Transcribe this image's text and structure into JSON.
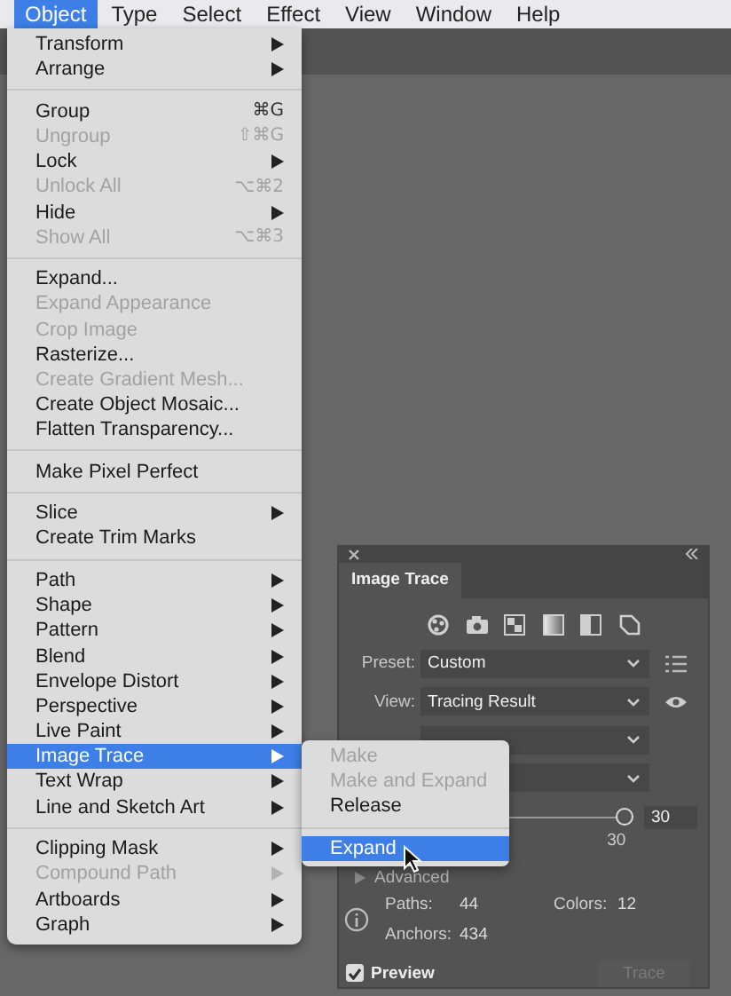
{
  "menubar": [
    {
      "label": "Object",
      "selected": true
    },
    {
      "label": "Type",
      "selected": false
    },
    {
      "label": "Select",
      "selected": false
    },
    {
      "label": "Effect",
      "selected": false
    },
    {
      "label": "View",
      "selected": false
    },
    {
      "label": "Window",
      "selected": false
    },
    {
      "label": "Help",
      "selected": false
    }
  ],
  "menu": {
    "items": [
      {
        "kind": "item",
        "label": "Transform",
        "submenu": true,
        "disabled": false,
        "selected": false
      },
      {
        "kind": "item",
        "label": "Arrange",
        "submenu": true,
        "disabled": false,
        "selected": false
      },
      {
        "kind": "separator"
      },
      {
        "kind": "item",
        "label": "Group",
        "shortcut": "⌘G",
        "disabled": false,
        "selected": false
      },
      {
        "kind": "item",
        "label": "Ungroup",
        "shortcut": "⇧⌘G",
        "disabled": true,
        "selected": false
      },
      {
        "kind": "item",
        "label": "Lock",
        "submenu": true,
        "disabled": false,
        "selected": false
      },
      {
        "kind": "item",
        "label": "Unlock All",
        "shortcut": "⌥⌘2",
        "disabled": true,
        "selected": false
      },
      {
        "kind": "item",
        "label": "Hide",
        "submenu": true,
        "disabled": false,
        "selected": false
      },
      {
        "kind": "item",
        "label": "Show All",
        "shortcut": "⌥⌘3",
        "disabled": true,
        "selected": false
      },
      {
        "kind": "separator"
      },
      {
        "kind": "item",
        "label": "Expand...",
        "disabled": false,
        "selected": false
      },
      {
        "kind": "item",
        "label": "Expand Appearance",
        "disabled": true,
        "selected": false
      },
      {
        "kind": "item",
        "label": "Crop Image",
        "disabled": true,
        "selected": false
      },
      {
        "kind": "item",
        "label": "Rasterize...",
        "disabled": false,
        "selected": false
      },
      {
        "kind": "item",
        "label": "Create Gradient Mesh...",
        "disabled": true,
        "selected": false
      },
      {
        "kind": "item",
        "label": "Create Object Mosaic...",
        "disabled": false,
        "selected": false
      },
      {
        "kind": "item",
        "label": "Flatten Transparency...",
        "disabled": false,
        "selected": false
      },
      {
        "kind": "separator"
      },
      {
        "kind": "item",
        "label": "Make Pixel Perfect",
        "disabled": false,
        "selected": false
      },
      {
        "kind": "separator"
      },
      {
        "kind": "item",
        "label": "Slice",
        "submenu": true,
        "disabled": false,
        "selected": false
      },
      {
        "kind": "item",
        "label": "Create Trim Marks",
        "disabled": false,
        "selected": false
      },
      {
        "kind": "separator"
      },
      {
        "kind": "item",
        "label": "Path",
        "submenu": true,
        "disabled": false,
        "selected": false
      },
      {
        "kind": "item",
        "label": "Shape",
        "submenu": true,
        "disabled": false,
        "selected": false
      },
      {
        "kind": "item",
        "label": "Pattern",
        "submenu": true,
        "disabled": false,
        "selected": false
      },
      {
        "kind": "item",
        "label": "Blend",
        "submenu": true,
        "disabled": false,
        "selected": false
      },
      {
        "kind": "item",
        "label": "Envelope Distort",
        "submenu": true,
        "disabled": false,
        "selected": false
      },
      {
        "kind": "item",
        "label": "Perspective",
        "submenu": true,
        "disabled": false,
        "selected": false
      },
      {
        "kind": "item",
        "label": "Live Paint",
        "submenu": true,
        "disabled": false,
        "selected": false
      },
      {
        "kind": "item",
        "label": "Image Trace",
        "submenu": true,
        "disabled": false,
        "selected": true
      },
      {
        "kind": "item",
        "label": "Text Wrap",
        "submenu": true,
        "disabled": false,
        "selected": false
      },
      {
        "kind": "item",
        "label": "Line and Sketch Art",
        "submenu": true,
        "disabled": false,
        "selected": false
      },
      {
        "kind": "separator"
      },
      {
        "kind": "item",
        "label": "Clipping Mask",
        "submenu": true,
        "disabled": false,
        "selected": false
      },
      {
        "kind": "item",
        "label": "Compound Path",
        "submenu": true,
        "disabled": true,
        "selected": false
      },
      {
        "kind": "item",
        "label": "Artboards",
        "submenu": true,
        "disabled": false,
        "selected": false
      },
      {
        "kind": "item",
        "label": "Graph",
        "submenu": true,
        "disabled": false,
        "selected": false
      }
    ]
  },
  "submenu": {
    "items": [
      {
        "kind": "item",
        "label": "Make",
        "disabled": true,
        "selected": false
      },
      {
        "kind": "item",
        "label": "Make and Expand",
        "disabled": true,
        "selected": false
      },
      {
        "kind": "item",
        "label": "Release",
        "disabled": false,
        "selected": false
      },
      {
        "kind": "separator"
      },
      {
        "kind": "item",
        "label": "Expand",
        "disabled": false,
        "selected": true
      }
    ]
  },
  "panel": {
    "title": "Image Trace",
    "preset": {
      "label": "Preset:",
      "value": "Custom"
    },
    "view": {
      "label": "View:",
      "value": "Tracing Result"
    },
    "slider": {
      "level": 0.96,
      "value": "30",
      "reading": "30"
    },
    "advanced": "Advanced",
    "stats": [
      {
        "label": "Paths:",
        "value": "44"
      },
      {
        "label": "Colors:",
        "value": "12"
      },
      {
        "label": "Anchors:",
        "value": "434"
      }
    ],
    "preview": {
      "label": "Preview",
      "checked": true
    },
    "trace": {
      "label": "Trace",
      "disabled": true
    }
  }
}
